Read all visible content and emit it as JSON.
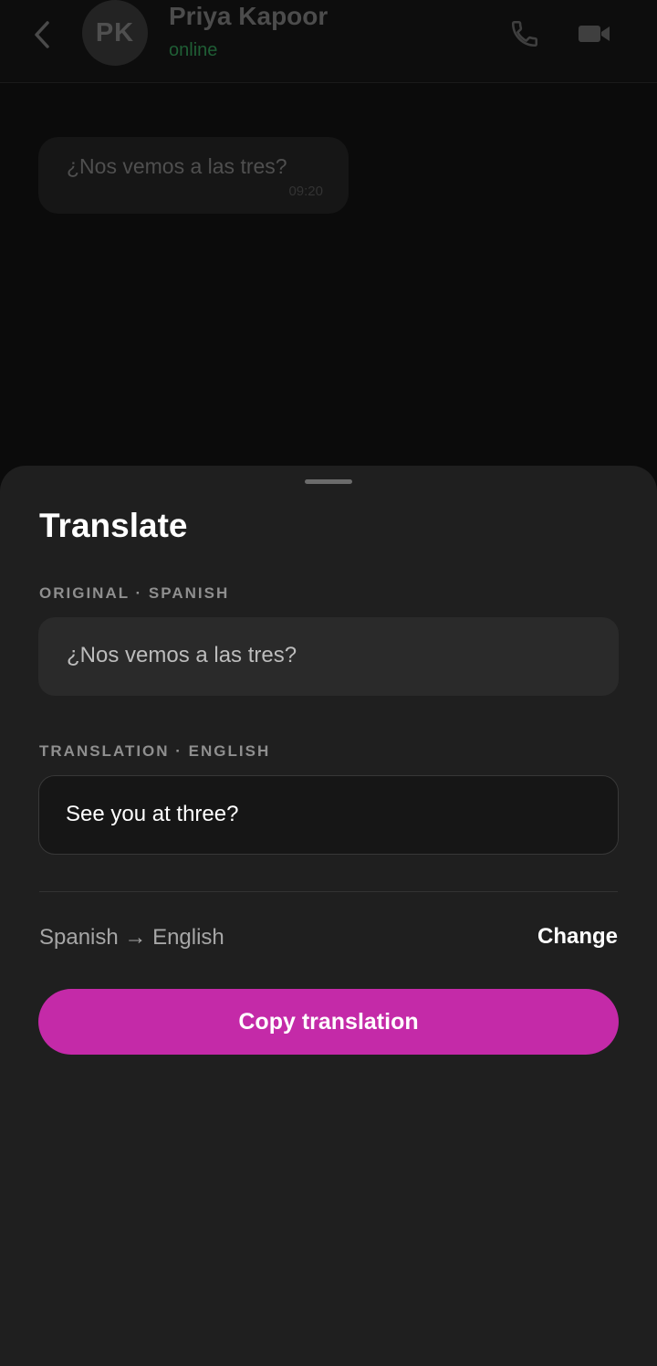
{
  "header": {
    "avatar_initials": "PK",
    "contact_name": "Priya Kapoor",
    "status": "online",
    "back_icon": "chevron-left-icon",
    "call_icon": "phone-icon",
    "video_icon": "video-camera-icon"
  },
  "chat": {
    "messages": [
      {
        "text": "¿Nos vemos a las tres?",
        "time": "09:20"
      }
    ]
  },
  "sheet": {
    "title": "Translate",
    "original_label": "ORIGINAL · SPANISH",
    "original_text": "¿Nos vemos a las tres?",
    "translation_label": "TRANSLATION · ENGLISH",
    "translation_text": "See you at three?",
    "language_pair": "Spanish → English",
    "change_label": "Change",
    "copy_label": "Copy translation"
  },
  "colors": {
    "accent": "#c42aa8",
    "status_online": "#1f5e35",
    "sheet_background": "#1f1f1f"
  }
}
